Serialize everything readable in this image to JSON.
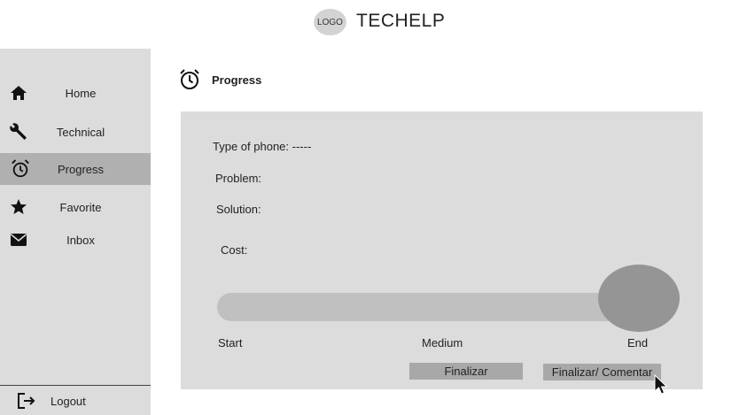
{
  "header": {
    "logo_text": "LOGO",
    "app_title": "TECHELP"
  },
  "sidebar": {
    "items": [
      {
        "label": "Home",
        "icon": "home-icon"
      },
      {
        "label": "Technical",
        "icon": "wrench-icon"
      },
      {
        "label": "Progress",
        "icon": "alarm-clock-icon",
        "active": true
      },
      {
        "label": "Favorite",
        "icon": "star-icon"
      },
      {
        "label": "Inbox",
        "icon": "envelope-icon"
      }
    ],
    "logout_label": "Logout"
  },
  "main": {
    "title": "Progress",
    "fields": {
      "phone_type": "Type of phone: -----",
      "problem": "Problem:",
      "solution": "Solution:",
      "cost": "Cost:"
    },
    "progress": {
      "value": 0.96,
      "labels": {
        "start": "Start",
        "medium": "Medium",
        "end": "End"
      }
    },
    "buttons": {
      "finalize": "Finalizar",
      "finalize_comment": "Finalizar/ Comentar"
    }
  },
  "colors": {
    "sidebar_bg": "#dcdcdc",
    "active_item": "#b0b0b0",
    "panel_bg": "#dcdcdc",
    "button_bg": "#a8a8a8"
  }
}
